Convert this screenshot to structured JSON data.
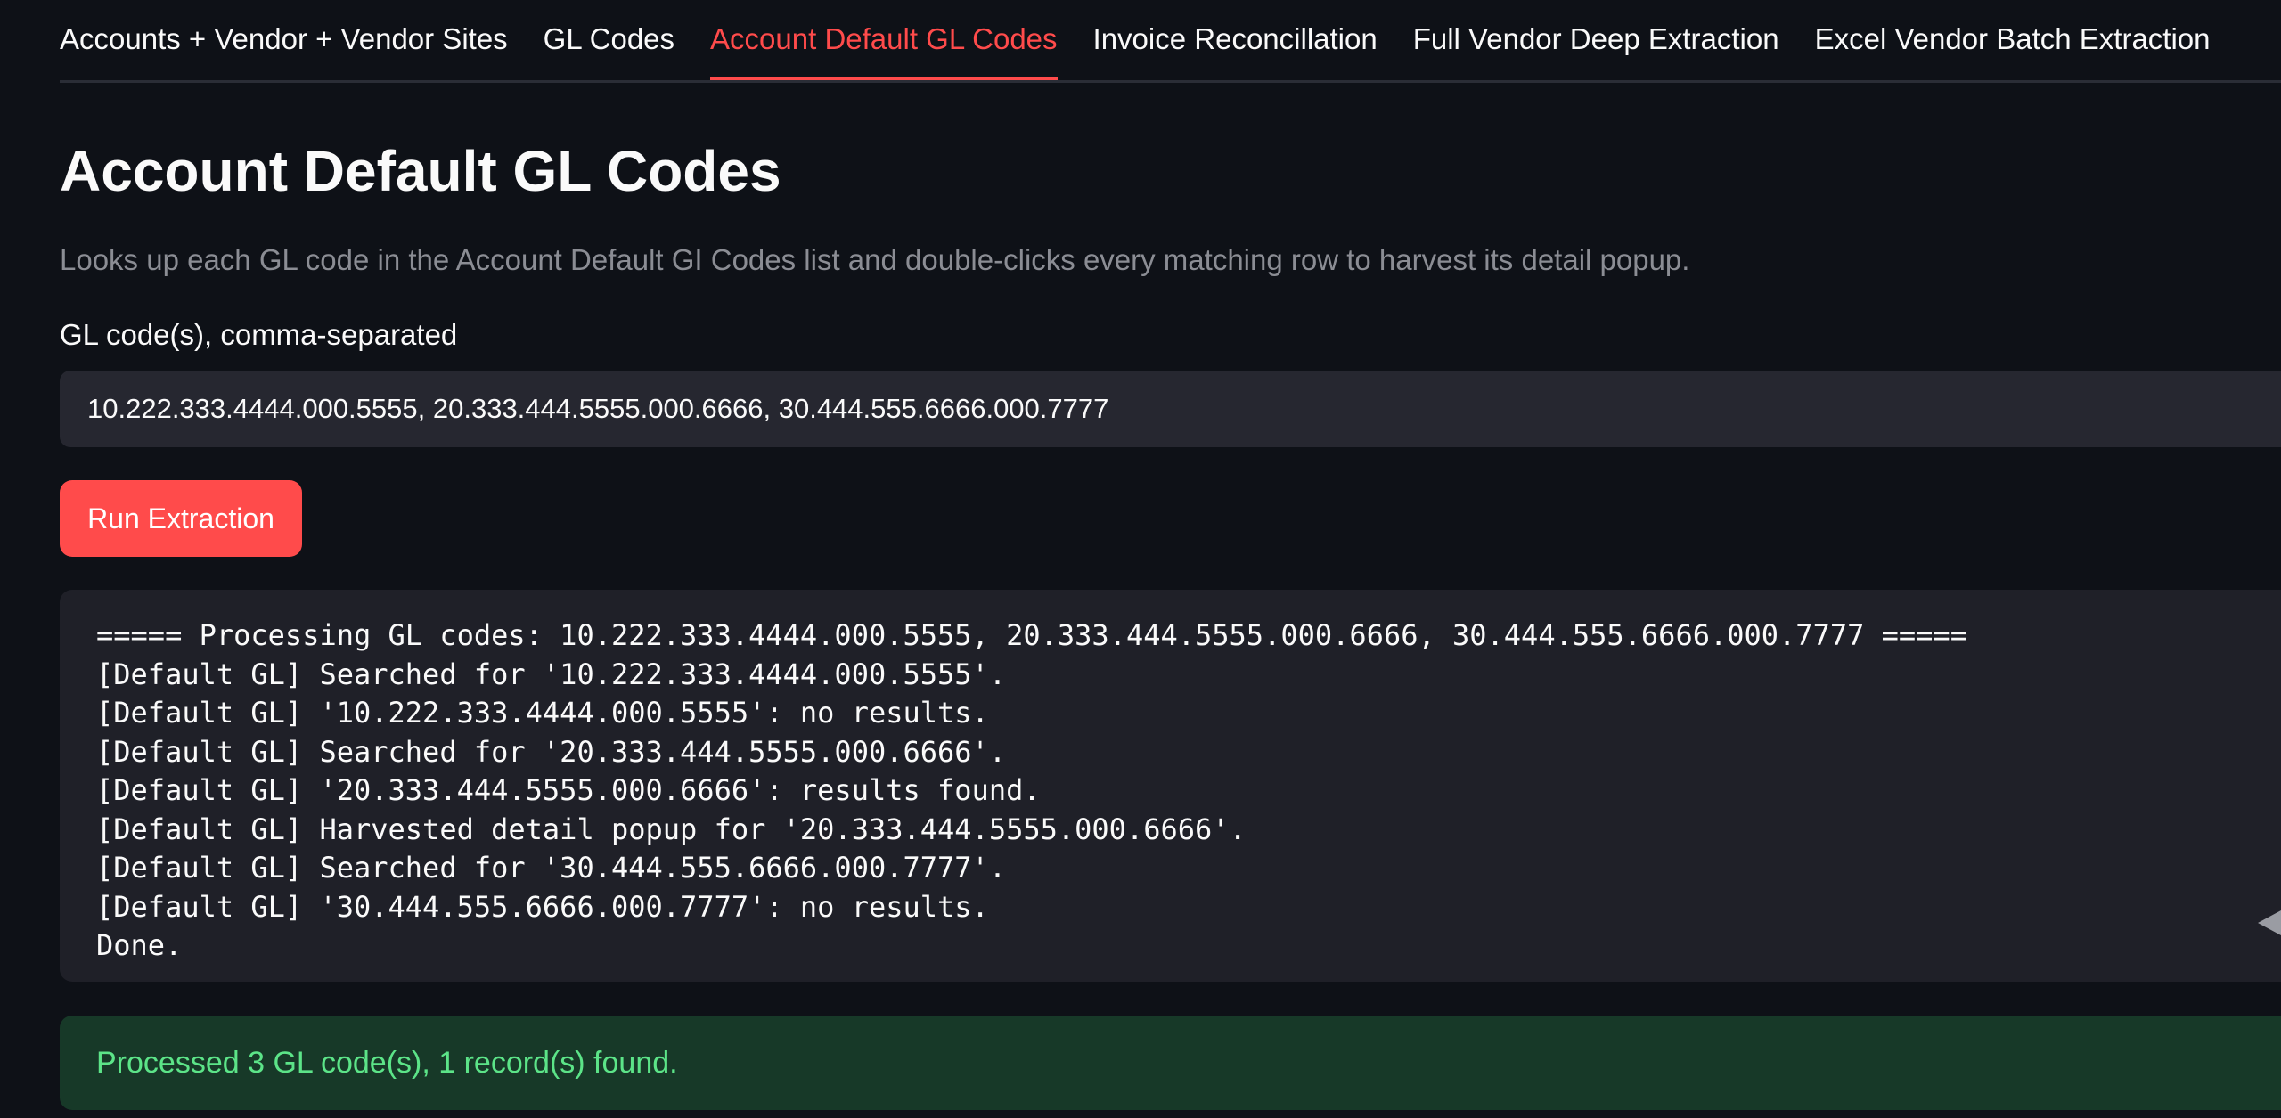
{
  "tabs": [
    {
      "label": "Accounts + Vendor + Vendor Sites",
      "active": false
    },
    {
      "label": "GL Codes",
      "active": false
    },
    {
      "label": "Account Default GL Codes",
      "active": true
    },
    {
      "label": "Invoice Reconcillation",
      "active": false
    },
    {
      "label": "Full Vendor Deep Extraction",
      "active": false
    },
    {
      "label": "Excel Vendor Batch Extraction",
      "active": false
    }
  ],
  "page": {
    "title": "Account Default GL Codes",
    "caption": "Looks up each GL code in the Account Default GI Codes list and double-clicks every matching row to harvest its detail popup."
  },
  "form": {
    "label": "GL code(s), comma-separated",
    "value": "10.222.333.4444.000.5555, 20.333.444.5555.000.6666, 30.444.555.6666.000.7777",
    "button_label": "Run Extraction"
  },
  "log": {
    "lines": [
      "===== Processing GL codes: 10.222.333.4444.000.5555, 20.333.444.5555.000.6666, 30.444.555.6666.000.7777 =====",
      "[Default GL] Searched for '10.222.333.4444.000.5555'.",
      "[Default GL] '10.222.333.4444.000.5555': no results.",
      "[Default GL] Searched for '20.333.444.5555.000.6666'.",
      "[Default GL] '20.333.444.5555.000.6666': results found.",
      "[Default GL] Harvested detail popup for '20.333.444.5555.000.6666'.",
      "[Default GL] Searched for '30.444.555.6666.000.7777'.",
      "[Default GL] '30.444.555.6666.000.7777': no results.",
      "Done."
    ]
  },
  "status": {
    "message": "Processed 3 GL code(s), 1 record(s) found."
  },
  "colors": {
    "accent": "#ff4b4b",
    "background": "#0e1117",
    "success_text": "#5ce488",
    "success_background": "#173928"
  }
}
